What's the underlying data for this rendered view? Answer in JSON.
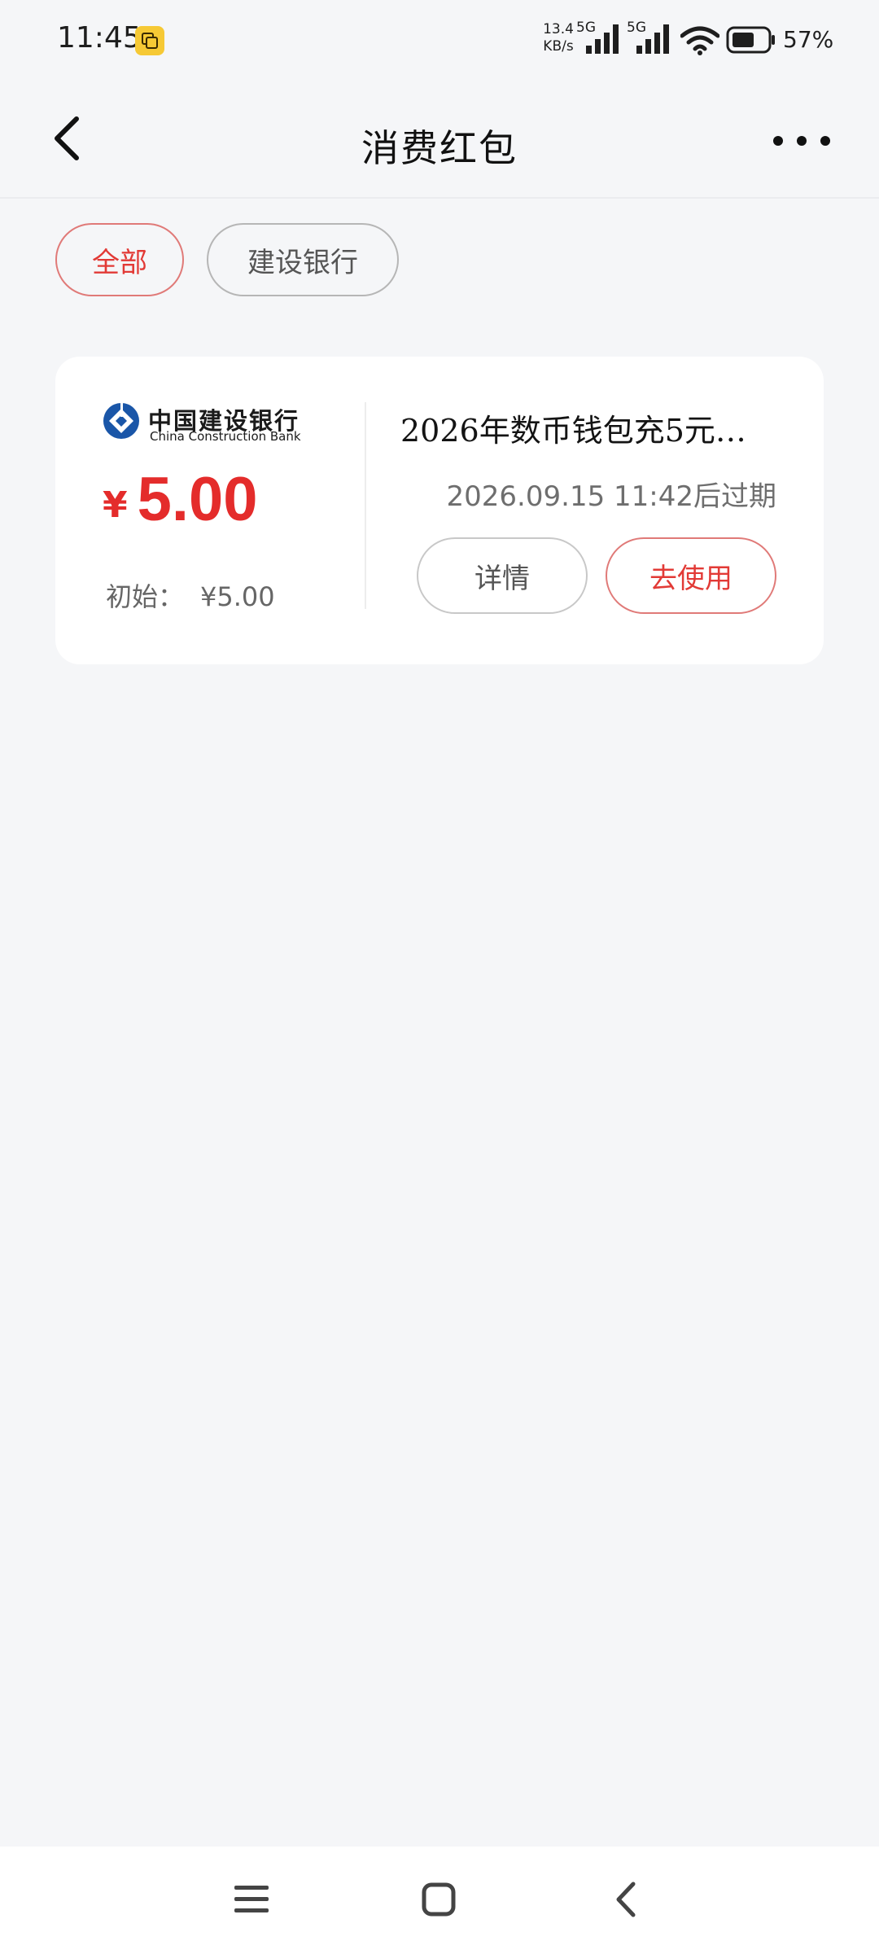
{
  "status_bar": {
    "time": "11:45",
    "network_speed_value": "13.4",
    "network_speed_unit": "KB/s",
    "sim1_type": "5G",
    "sim2_type": "5G",
    "battery": "57%",
    "icons": [
      "notification-app-icon",
      "signal-icon",
      "wifi-icon",
      "battery-icon"
    ]
  },
  "header": {
    "title": "消费红包",
    "back_icon": "chevron-left-icon",
    "more_icon": "more-dots-icon"
  },
  "filters": {
    "items": [
      {
        "label": "全部",
        "selected": true
      },
      {
        "label": "建设银行",
        "selected": false
      }
    ]
  },
  "card": {
    "bank_name_cn": "中国建设银行",
    "bank_name_en": "China Construction Bank",
    "currency_symbol": "¥",
    "amount": "5.00",
    "initial_label": "初始：",
    "initial_value": "¥5.00",
    "title": "2026年数币钱包充5元…",
    "expiry": "2026.09.15  11:42后过期",
    "detail_button": "详情",
    "use_button": "去使用"
  },
  "colors": {
    "accent_red": "#e42c2b",
    "background": "#f5f6f8",
    "ccb_blue": "#1a56a8"
  },
  "nav_bar": {
    "icons": [
      "menu-icon",
      "home-square-icon",
      "back-triangle-icon"
    ]
  }
}
